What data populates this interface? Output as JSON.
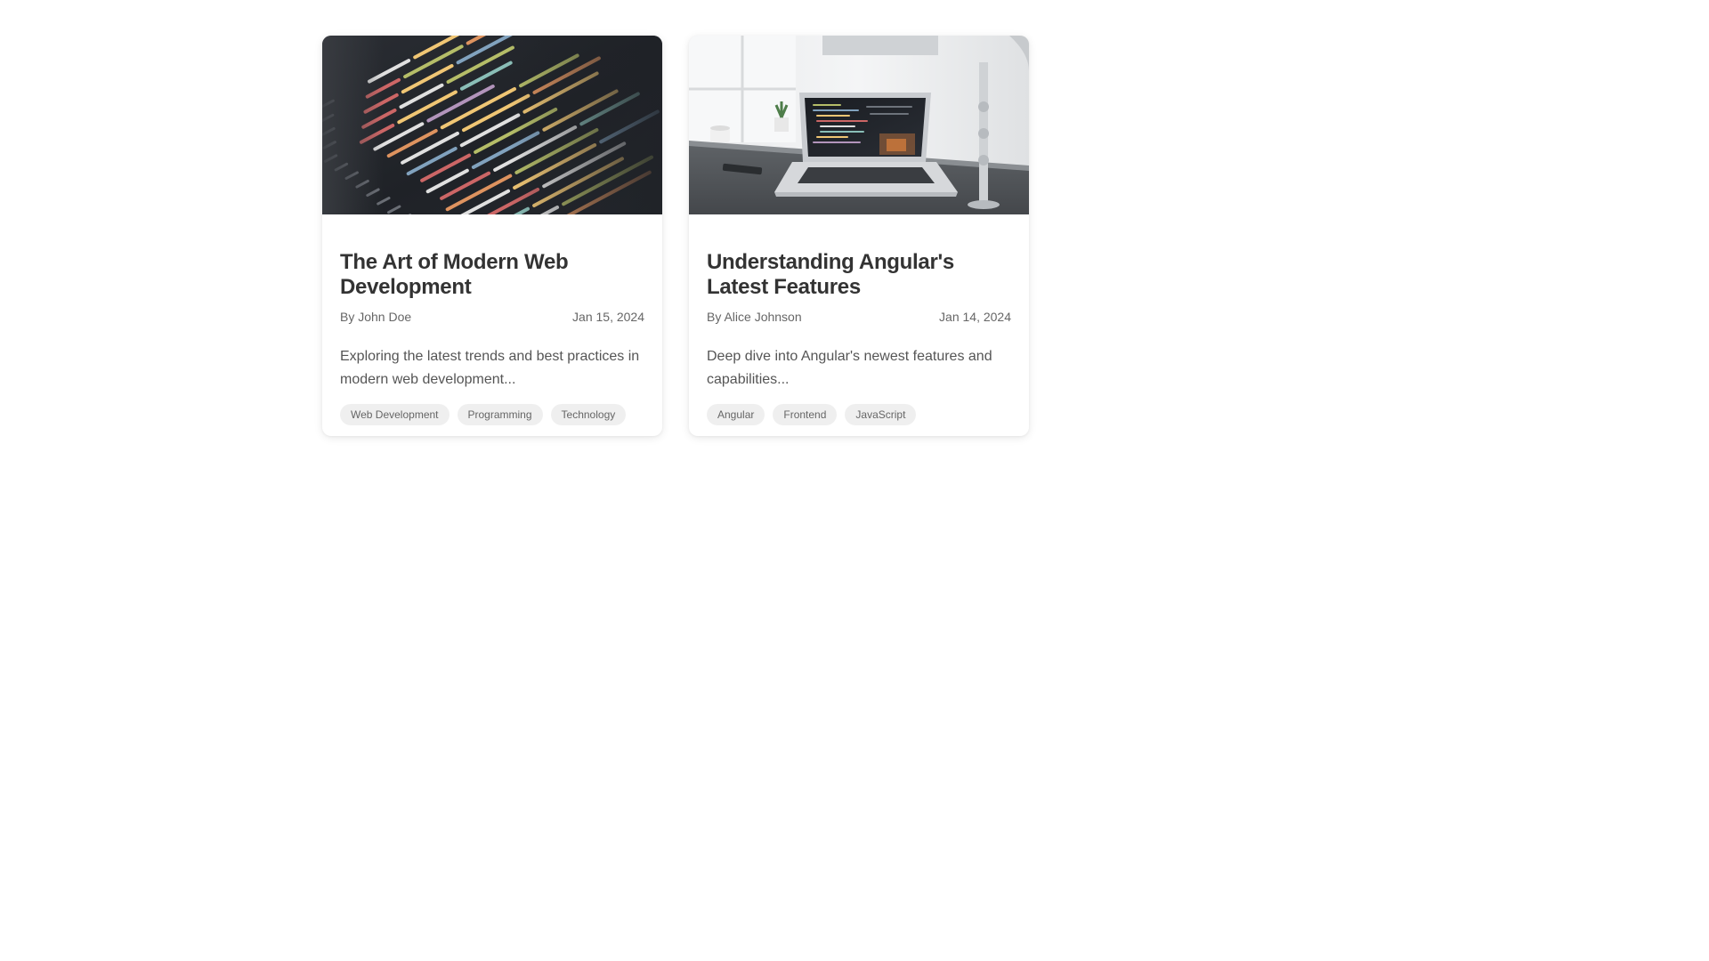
{
  "posts": [
    {
      "image_icon": "code-editor-image",
      "title": "The Art of Modern Web Development",
      "author": "By John Doe",
      "date": "Jan 15, 2024",
      "excerpt": "Exploring the latest trends and best practices in modern web development...",
      "tags": [
        "Web Development",
        "Programming",
        "Technology"
      ]
    },
    {
      "image_icon": "laptop-desk-image",
      "title": "Understanding Angular's Latest Features",
      "author": "By Alice Johnson",
      "date": "Jan 14, 2024",
      "excerpt": "Deep dive into Angular's newest features and capabilities...",
      "tags": [
        "Angular",
        "Frontend",
        "JavaScript"
      ]
    }
  ],
  "colors": {
    "title": "#333333",
    "meta": "#666666",
    "excerpt": "#555555",
    "tag_bg": "#efefef"
  }
}
